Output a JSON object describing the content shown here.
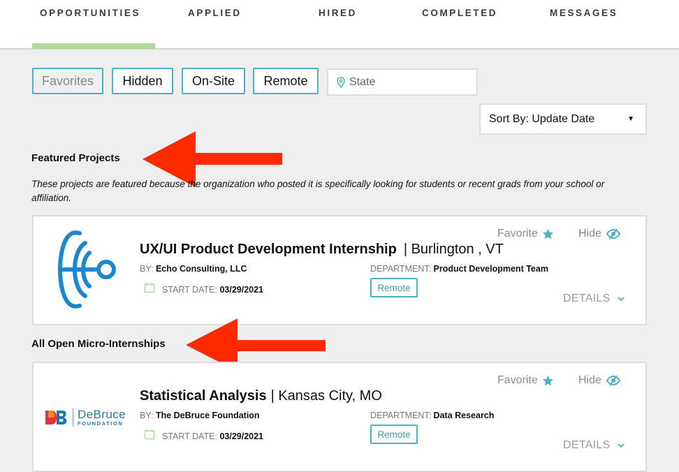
{
  "tabs": [
    {
      "label": "OPPORTUNITIES",
      "active": true
    },
    {
      "label": "APPLIED",
      "active": false
    },
    {
      "label": "HIRED",
      "active": false
    },
    {
      "label": "COMPLETED",
      "active": false
    },
    {
      "label": "MESSAGES",
      "active": false
    }
  ],
  "filters": {
    "favorites": "Favorites",
    "hidden": "Hidden",
    "onsite": "On-Site",
    "remote": "Remote",
    "state_placeholder": "State",
    "state_value": ""
  },
  "sort": {
    "label": "Sort By: Update Date",
    "caret": "▼"
  },
  "featured": {
    "title": "Featured Projects",
    "description": "These projects are featured because the organization who posted it is specifically looking for students or recent grads from your school or affiliation."
  },
  "all_open": {
    "title": "All Open Micro-Internships"
  },
  "labels": {
    "by": "BY:",
    "start_date": "START DATE:",
    "department": "DEPARTMENT:",
    "favorite": "Favorite",
    "hide": "Hide",
    "details": "DETAILS"
  },
  "projects": [
    {
      "title": "UX/UI Product Development Internship",
      "location": "| Burlington , VT",
      "by": "Echo Consulting, LLC",
      "start_date": "03/29/2021",
      "department": "Product Development Team",
      "tag": "Remote",
      "logo": "echo-logo"
    },
    {
      "title": "Statistical Analysis",
      "location": "| Kansas City, MO",
      "by": "The DeBruce Foundation",
      "start_date": "03/29/2021",
      "department": "Data Research",
      "tag": "Remote",
      "logo": "debruce-logo",
      "logo_text": {
        "name": "DeBruce",
        "sub": "FOUNDATION",
        "mark": "DB"
      }
    }
  ],
  "colors": {
    "accent": "#4bb2c0",
    "tab_underline": "#aed99b",
    "annotation_arrow": "#ff2a00",
    "echo_blue": "#1b87cf"
  }
}
